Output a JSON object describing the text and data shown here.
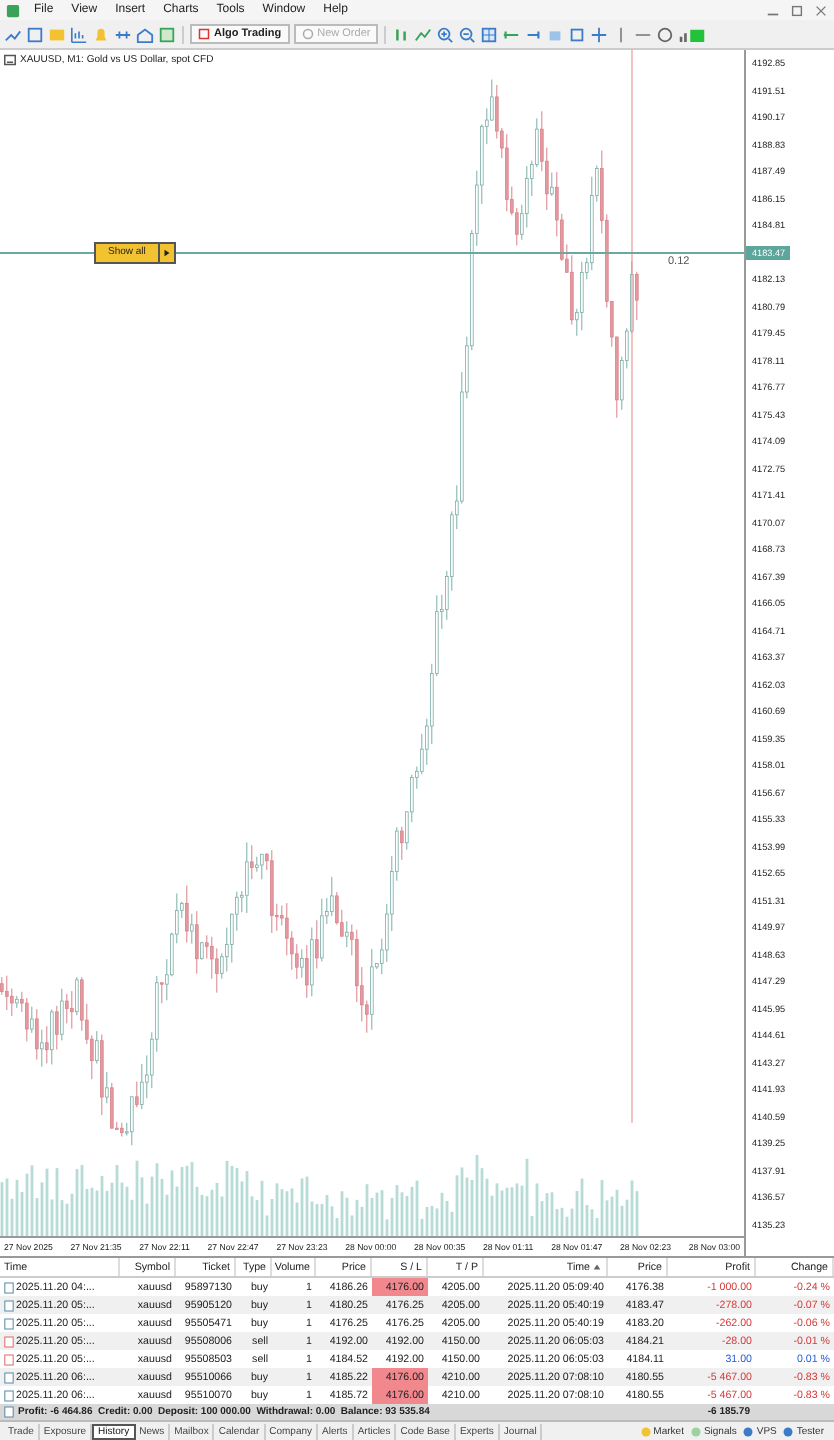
{
  "menu": [
    "File",
    "View",
    "Insert",
    "Charts",
    "Tools",
    "Window",
    "Help"
  ],
  "toolbar": {
    "algo_trading": "Algo Trading",
    "new_order": {
      "label": "New Order",
      "disabled": true
    }
  },
  "chart": {
    "title": "XAUUSD, M1: Gold vs US Dollar, spot CFD",
    "show_all": "Show all",
    "value_label": "0.12",
    "price_labels": [
      {
        "text": "4192.85",
        "current": false
      },
      {
        "text": "4191.51",
        "current": false
      },
      {
        "text": "4190.17",
        "current": false
      },
      {
        "text": "4188.83",
        "current": false
      },
      {
        "text": "4187.49",
        "current": false
      },
      {
        "text": "4186.15",
        "current": false
      },
      {
        "text": "4184.81",
        "current": false
      },
      {
        "text": "4183.47",
        "current": true
      },
      {
        "text": "4182.13",
        "current": false
      },
      {
        "text": "4180.79",
        "current": false
      },
      {
        "text": "4179.45",
        "current": false
      },
      {
        "text": "4178.11",
        "current": false
      },
      {
        "text": "4176.77",
        "current": false
      },
      {
        "text": "4175.43",
        "current": false
      },
      {
        "text": "4174.09",
        "current": false
      },
      {
        "text": "4172.75",
        "current": false
      },
      {
        "text": "4171.41",
        "current": false
      },
      {
        "text": "4170.07",
        "current": false
      },
      {
        "text": "4168.73",
        "current": false
      },
      {
        "text": "4167.39",
        "current": false
      },
      {
        "text": "4166.05",
        "current": false
      },
      {
        "text": "4164.71",
        "current": false
      },
      {
        "text": "4163.37",
        "current": false
      },
      {
        "text": "4162.03",
        "current": false
      },
      {
        "text": "4160.69",
        "current": false
      },
      {
        "text": "4159.35",
        "current": false
      },
      {
        "text": "4158.01",
        "current": false
      },
      {
        "text": "4156.67",
        "current": false
      },
      {
        "text": "4155.33",
        "current": false
      },
      {
        "text": "4153.99",
        "current": false
      },
      {
        "text": "4152.65",
        "current": false
      },
      {
        "text": "4151.31",
        "current": false
      },
      {
        "text": "4149.97",
        "current": false
      },
      {
        "text": "4148.63",
        "current": false
      },
      {
        "text": "4147.29",
        "current": false
      },
      {
        "text": "4145.95",
        "current": false
      },
      {
        "text": "4144.61",
        "current": false
      },
      {
        "text": "4143.27",
        "current": false
      },
      {
        "text": "4141.93",
        "current": false
      },
      {
        "text": "4140.59",
        "current": false
      },
      {
        "text": "4139.25",
        "current": false
      },
      {
        "text": "4137.91",
        "current": false
      },
      {
        "text": "4136.57",
        "current": false
      },
      {
        "text": "4135.23",
        "current": false
      }
    ],
    "time_labels": [
      "27 Nov 2025",
      "27 Nov 21:35",
      "27 Nov 22:11",
      "27 Nov 22:47",
      "27 Nov 23:23",
      "28 Nov 00:00",
      "28 Nov 00:35",
      "28 Nov 01:11",
      "28 Nov 01:47",
      "28 Nov 02:23",
      "28 Nov 03:00"
    ]
  },
  "table": {
    "columns": [
      {
        "label": "Time",
        "sorted": false
      },
      {
        "label": "Symbol",
        "sorted": false
      },
      {
        "label": "Ticket",
        "sorted": false
      },
      {
        "label": "Type",
        "sorted": false
      },
      {
        "label": "Volume",
        "sorted": false
      },
      {
        "label": "Price",
        "sorted": false
      },
      {
        "label": "S / L",
        "sorted": false
      },
      {
        "label": "T / P",
        "sorted": false
      },
      {
        "label": "Time",
        "sorted": true
      },
      {
        "label": "Price",
        "sorted": false
      },
      {
        "label": "Profit",
        "sorted": false
      },
      {
        "label": "Change",
        "sorted": false
      }
    ],
    "rows": [
      {
        "time": "2025.11.20 04:...",
        "symbol": "xauusd",
        "ticket": "95897130",
        "type": "buy",
        "volume": "1",
        "price": "4186.26",
        "sl": "4176.00",
        "sl_hit": true,
        "tp": "4205.00",
        "close_time": "2025.11.20 05:09:40",
        "close_price": "4176.38",
        "profit": "-1 000.00",
        "negative": true,
        "change": "-0.24 %"
      },
      {
        "time": "2025.11.20 05:...",
        "symbol": "xauusd",
        "ticket": "95905120",
        "type": "buy",
        "volume": "1",
        "price": "4180.25",
        "sl": "4176.25",
        "sl_hit": false,
        "tp": "4205.00",
        "close_time": "2025.11.20 05:40:19",
        "close_price": "4183.47",
        "profit": "-278.00",
        "negative": true,
        "change": "-0.07 %"
      },
      {
        "time": "2025.11.20 05:...",
        "symbol": "xauusd",
        "ticket": "95505471",
        "type": "buy",
        "volume": "1",
        "price": "4176.25",
        "sl": "4176.25",
        "sl_hit": false,
        "tp": "4205.00",
        "close_time": "2025.11.20 05:40:19",
        "close_price": "4183.20",
        "profit": "-262.00",
        "negative": true,
        "change": "-0.06 %"
      },
      {
        "time": "2025.11.20 05:...",
        "symbol": "xauusd",
        "ticket": "95508006",
        "type": "sell",
        "volume": "1",
        "price": "4192.00",
        "sl": "4192.00",
        "sl_hit": false,
        "tp": "4150.00",
        "close_time": "2025.11.20 06:05:03",
        "close_price": "4184.21",
        "profit": "-28.00",
        "negative": true,
        "change": "-0.01 %"
      },
      {
        "time": "2025.11.20 05:...",
        "symbol": "xauusd",
        "ticket": "95508503",
        "type": "sell",
        "volume": "1",
        "price": "4184.52",
        "sl": "4192.00",
        "sl_hit": false,
        "tp": "4150.00",
        "close_time": "2025.11.20 06:05:03",
        "close_price": "4184.11",
        "profit": "31.00",
        "negative": false,
        "change": "0.01 %"
      },
      {
        "time": "2025.11.20 06:...",
        "symbol": "xauusd",
        "ticket": "95510066",
        "type": "buy",
        "volume": "1",
        "price": "4185.22",
        "sl": "4176.00",
        "sl_hit": true,
        "tp": "4210.00",
        "close_time": "2025.11.20 07:08:10",
        "close_price": "4180.55",
        "profit": "-5 467.00",
        "negative": true,
        "change": "-0.83 %"
      },
      {
        "time": "2025.11.20 06:...",
        "symbol": "xauusd",
        "ticket": "95510070",
        "type": "buy",
        "volume": "1",
        "price": "4185.72",
        "sl": "4176.00",
        "sl_hit": true,
        "tp": "4210.00",
        "close_time": "2025.11.20 07:08:10",
        "close_price": "4180.55",
        "profit": "-5 467.00",
        "negative": true,
        "change": "-0.83 %"
      }
    ],
    "summary": "Profit: -6 464.86  Credit: 0.00  Deposit: 100 000.00  Withdrawal: 0.00  Balance: 93 535.84",
    "total": "-6 185.79"
  },
  "tabs": [
    {
      "label": "Trade",
      "selected": false
    },
    {
      "label": "Exposure",
      "selected": false
    },
    {
      "label": "History",
      "selected": true
    },
    {
      "label": "News",
      "selected": false
    },
    {
      "label": "Mailbox",
      "selected": false
    },
    {
      "label": "Calendar",
      "selected": false
    },
    {
      "label": "Company",
      "selected": false
    },
    {
      "label": "Alerts",
      "selected": false
    },
    {
      "label": "Articles",
      "selected": false
    },
    {
      "label": "Code Base",
      "selected": false
    },
    {
      "label": "Experts",
      "selected": false
    },
    {
      "label": "Journal",
      "selected": false
    }
  ],
  "status_tabs": [
    "Market",
    "Signals",
    "VPS",
    "Tester"
  ]
}
